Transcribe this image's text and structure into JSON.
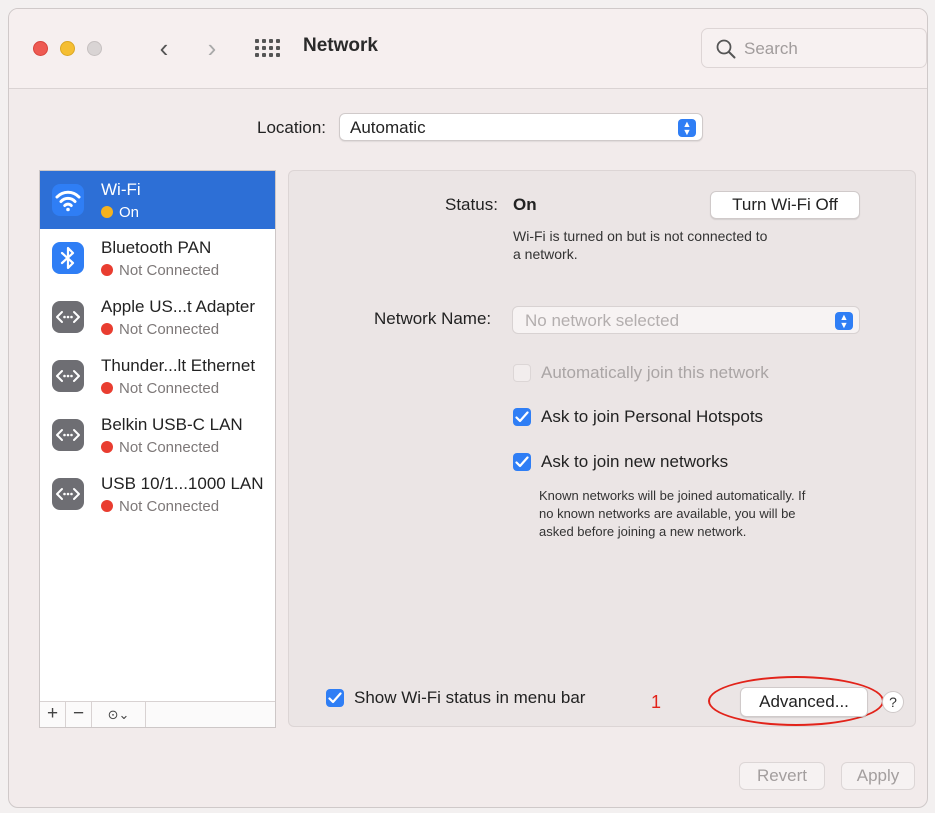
{
  "window": {
    "title": "Network",
    "search_placeholder": "Search"
  },
  "location": {
    "label": "Location:",
    "value": "Automatic"
  },
  "services": [
    {
      "name": "Wi-Fi",
      "status": "On",
      "status_color": "#f5b21e",
      "selected": true
    },
    {
      "name": "Bluetooth PAN",
      "status": "Not Connected",
      "status_color": "#e93d30",
      "selected": false
    },
    {
      "name": "Apple US...t Adapter",
      "status": "Not Connected",
      "status_color": "#e93d30",
      "selected": false
    },
    {
      "name": "Thunder...lt Ethernet",
      "status": "Not Connected",
      "status_color": "#e93d30",
      "selected": false
    },
    {
      "name": "Belkin USB-C LAN",
      "status": "Not Connected",
      "status_color": "#e93d30",
      "selected": false
    },
    {
      "name": "USB 10/1...1000 LAN",
      "status": "Not Connected",
      "status_color": "#e93d30",
      "selected": false
    }
  ],
  "sidebar_buttons": {
    "add": "+",
    "remove": "−",
    "more": "⊙⌄"
  },
  "detail": {
    "status_label": "Status:",
    "status_value": "On",
    "toggle_button": "Turn Wi-Fi Off",
    "status_desc_line1": "Wi-Fi is turned on but is not connected to",
    "status_desc_line2": "a network.",
    "network_name_label": "Network Name:",
    "network_name_placeholder": "No network selected",
    "auto_join_label": "Automatically join this network",
    "auto_join_checked": false,
    "hotspots_label": "Ask to join Personal Hotspots",
    "hotspots_checked": true,
    "new_networks_label": "Ask to join new networks",
    "new_networks_checked": true,
    "new_networks_note_1": "Known networks will be joined automatically. If",
    "new_networks_note_2": "no known networks are available, you will be",
    "new_networks_note_3": "asked before joining a new network.",
    "show_status_label": "Show Wi-Fi status in menu bar",
    "show_status_checked": true,
    "advanced_button": "Advanced...",
    "help_button": "?"
  },
  "annotation": {
    "step_number": "1",
    "color": "#e2231a"
  },
  "footer": {
    "revert_button": "Revert",
    "apply_button": "Apply"
  },
  "colors": {
    "accent": "#2f7ef5",
    "selection": "#2d6fd6"
  }
}
